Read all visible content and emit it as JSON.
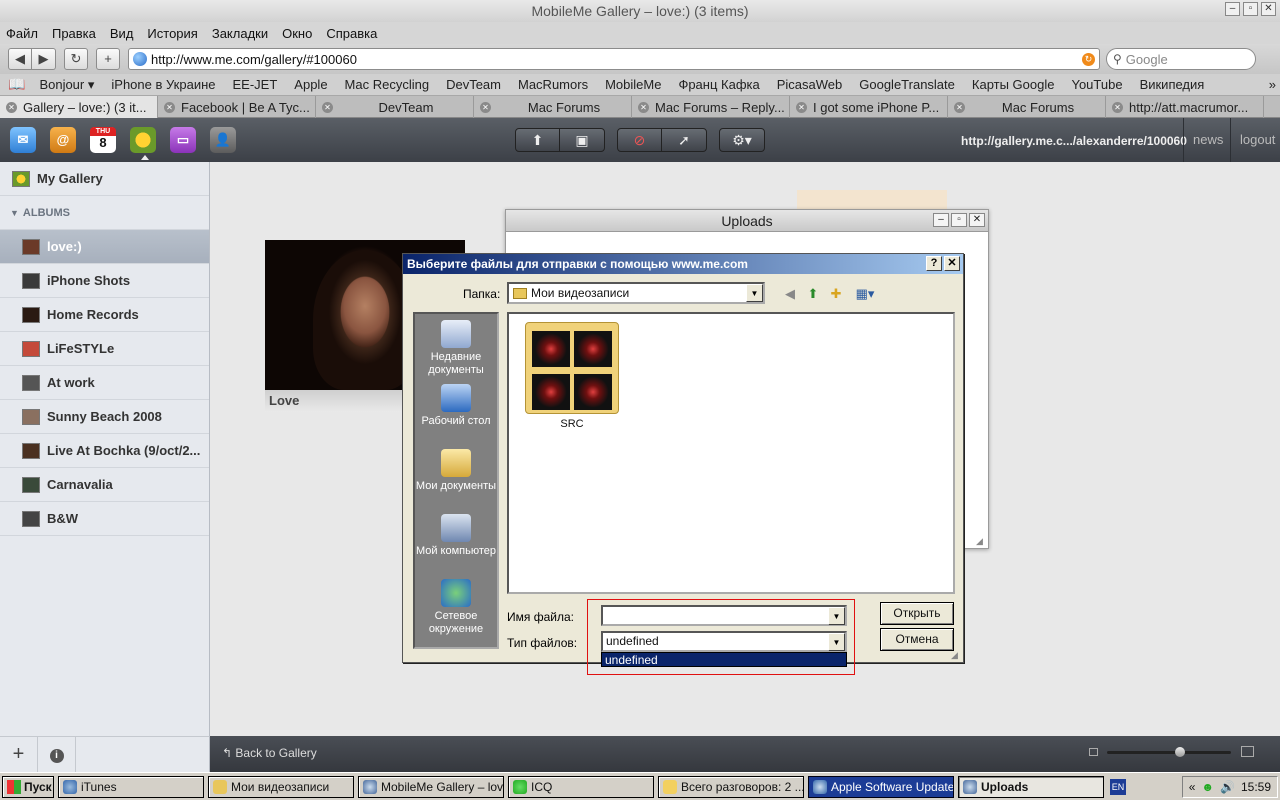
{
  "window": {
    "title": "MobileMe Gallery – love:) (3 items)"
  },
  "menu": [
    "Файл",
    "Правка",
    "Вид",
    "История",
    "Закладки",
    "Окно",
    "Справка"
  ],
  "nav": {
    "url": "http://www.me.com/gallery/#100060",
    "search_placeholder": "Google"
  },
  "bookmarks": [
    "Bonjour ▾",
    "iPhone в Украине",
    "EE-JET",
    "Apple",
    "Mac Recycling",
    "DevTeam",
    "MacRumors",
    "MobileMe",
    "Франц Кафка",
    "PicasaWeb",
    "GoogleTranslate",
    "Карты Google",
    "YouTube",
    "Википедия"
  ],
  "tabs": [
    "Gallery – love:) (3 it...",
    "Facebook | Be A Tyc...",
    "DevTeam",
    "Mac Forums",
    "Mac Forums – Reply...",
    "I got some iPhone P...",
    "Mac Forums",
    "http://att.macrumor..."
  ],
  "app_toolbar": {
    "calendar_day": "THU",
    "calendar_date": "8",
    "gallery_url": "http://gallery.me.c.../alexanderre/100060",
    "news": "news",
    "logout": "logout"
  },
  "sidebar": {
    "my_gallery": "My Gallery",
    "albums_heading": "ALBUMS",
    "albums": [
      {
        "label": "love:)",
        "selected": true,
        "color": "#6b3a28"
      },
      {
        "label": "iPhone Shots",
        "color": "#3a3a3a"
      },
      {
        "label": "Home Records",
        "color": "#2a1a12"
      },
      {
        "label": "LiFeSTYLe",
        "color": "#c44a3a"
      },
      {
        "label": "At work",
        "color": "#555"
      },
      {
        "label": "Sunny Beach 2008",
        "color": "#8a7060"
      },
      {
        "label": "Live At Bochka (9/oct/2...",
        "color": "#4a3020"
      },
      {
        "label": "Carnavalia",
        "color": "#3a4a3a"
      },
      {
        "label": "B&W",
        "color": "#444"
      }
    ]
  },
  "album_card": {
    "caption": "Love"
  },
  "uploads_window": {
    "title": "Uploads"
  },
  "file_dialog": {
    "title": "Выберите файлы для отправки с помощью www.me.com",
    "folder_label": "Папка:",
    "folder_value": "Мои видеозаписи",
    "places": [
      "Недавние документы",
      "Рабочий стол",
      "Мои документы",
      "Мой компьютер",
      "Сетевое окружение"
    ],
    "folder_item": "SRC",
    "filename_label": "Имя файла:",
    "filename_value": "",
    "filetype_label": "Тип файлов:",
    "filetype_value": "undefined",
    "filetype_option": "undefined",
    "open_button": "Открыть",
    "cancel_button": "Отмена"
  },
  "bottom_bar": {
    "back": "Back to Gallery",
    "zoom_level": 0.55
  },
  "taskbar": {
    "start": "Пуск",
    "tasks": [
      "iTunes",
      "Мои видеозаписи",
      "MobileMe Gallery – lov...",
      "ICQ",
      "Всего разговоров: 2 ...",
      "Apple Software Update",
      "Uploads"
    ],
    "lang": "EN",
    "clock": "15:59"
  }
}
